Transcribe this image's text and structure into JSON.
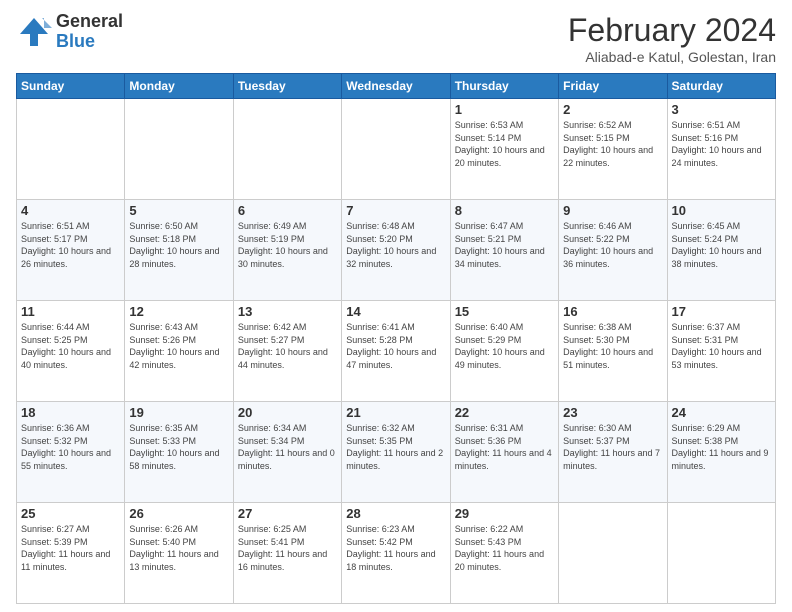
{
  "header": {
    "logo_general": "General",
    "logo_blue": "Blue",
    "title": "February 2024",
    "location": "Aliabad-e Katul, Golestan, Iran"
  },
  "days_of_week": [
    "Sunday",
    "Monday",
    "Tuesday",
    "Wednesday",
    "Thursday",
    "Friday",
    "Saturday"
  ],
  "weeks": [
    [
      {
        "day": "",
        "info": ""
      },
      {
        "day": "",
        "info": ""
      },
      {
        "day": "",
        "info": ""
      },
      {
        "day": "",
        "info": ""
      },
      {
        "day": "1",
        "info": "Sunrise: 6:53 AM\nSunset: 5:14 PM\nDaylight: 10 hours\nand 20 minutes."
      },
      {
        "day": "2",
        "info": "Sunrise: 6:52 AM\nSunset: 5:15 PM\nDaylight: 10 hours\nand 22 minutes."
      },
      {
        "day": "3",
        "info": "Sunrise: 6:51 AM\nSunset: 5:16 PM\nDaylight: 10 hours\nand 24 minutes."
      }
    ],
    [
      {
        "day": "4",
        "info": "Sunrise: 6:51 AM\nSunset: 5:17 PM\nDaylight: 10 hours\nand 26 minutes."
      },
      {
        "day": "5",
        "info": "Sunrise: 6:50 AM\nSunset: 5:18 PM\nDaylight: 10 hours\nand 28 minutes."
      },
      {
        "day": "6",
        "info": "Sunrise: 6:49 AM\nSunset: 5:19 PM\nDaylight: 10 hours\nand 30 minutes."
      },
      {
        "day": "7",
        "info": "Sunrise: 6:48 AM\nSunset: 5:20 PM\nDaylight: 10 hours\nand 32 minutes."
      },
      {
        "day": "8",
        "info": "Sunrise: 6:47 AM\nSunset: 5:21 PM\nDaylight: 10 hours\nand 34 minutes."
      },
      {
        "day": "9",
        "info": "Sunrise: 6:46 AM\nSunset: 5:22 PM\nDaylight: 10 hours\nand 36 minutes."
      },
      {
        "day": "10",
        "info": "Sunrise: 6:45 AM\nSunset: 5:24 PM\nDaylight: 10 hours\nand 38 minutes."
      }
    ],
    [
      {
        "day": "11",
        "info": "Sunrise: 6:44 AM\nSunset: 5:25 PM\nDaylight: 10 hours\nand 40 minutes."
      },
      {
        "day": "12",
        "info": "Sunrise: 6:43 AM\nSunset: 5:26 PM\nDaylight: 10 hours\nand 42 minutes."
      },
      {
        "day": "13",
        "info": "Sunrise: 6:42 AM\nSunset: 5:27 PM\nDaylight: 10 hours\nand 44 minutes."
      },
      {
        "day": "14",
        "info": "Sunrise: 6:41 AM\nSunset: 5:28 PM\nDaylight: 10 hours\nand 47 minutes."
      },
      {
        "day": "15",
        "info": "Sunrise: 6:40 AM\nSunset: 5:29 PM\nDaylight: 10 hours\nand 49 minutes."
      },
      {
        "day": "16",
        "info": "Sunrise: 6:38 AM\nSunset: 5:30 PM\nDaylight: 10 hours\nand 51 minutes."
      },
      {
        "day": "17",
        "info": "Sunrise: 6:37 AM\nSunset: 5:31 PM\nDaylight: 10 hours\nand 53 minutes."
      }
    ],
    [
      {
        "day": "18",
        "info": "Sunrise: 6:36 AM\nSunset: 5:32 PM\nDaylight: 10 hours\nand 55 minutes."
      },
      {
        "day": "19",
        "info": "Sunrise: 6:35 AM\nSunset: 5:33 PM\nDaylight: 10 hours\nand 58 minutes."
      },
      {
        "day": "20",
        "info": "Sunrise: 6:34 AM\nSunset: 5:34 PM\nDaylight: 11 hours\nand 0 minutes."
      },
      {
        "day": "21",
        "info": "Sunrise: 6:32 AM\nSunset: 5:35 PM\nDaylight: 11 hours\nand 2 minutes."
      },
      {
        "day": "22",
        "info": "Sunrise: 6:31 AM\nSunset: 5:36 PM\nDaylight: 11 hours\nand 4 minutes."
      },
      {
        "day": "23",
        "info": "Sunrise: 6:30 AM\nSunset: 5:37 PM\nDaylight: 11 hours\nand 7 minutes."
      },
      {
        "day": "24",
        "info": "Sunrise: 6:29 AM\nSunset: 5:38 PM\nDaylight: 11 hours\nand 9 minutes."
      }
    ],
    [
      {
        "day": "25",
        "info": "Sunrise: 6:27 AM\nSunset: 5:39 PM\nDaylight: 11 hours\nand 11 minutes."
      },
      {
        "day": "26",
        "info": "Sunrise: 6:26 AM\nSunset: 5:40 PM\nDaylight: 11 hours\nand 13 minutes."
      },
      {
        "day": "27",
        "info": "Sunrise: 6:25 AM\nSunset: 5:41 PM\nDaylight: 11 hours\nand 16 minutes."
      },
      {
        "day": "28",
        "info": "Sunrise: 6:23 AM\nSunset: 5:42 PM\nDaylight: 11 hours\nand 18 minutes."
      },
      {
        "day": "29",
        "info": "Sunrise: 6:22 AM\nSunset: 5:43 PM\nDaylight: 11 hours\nand 20 minutes."
      },
      {
        "day": "",
        "info": ""
      },
      {
        "day": "",
        "info": ""
      }
    ]
  ]
}
